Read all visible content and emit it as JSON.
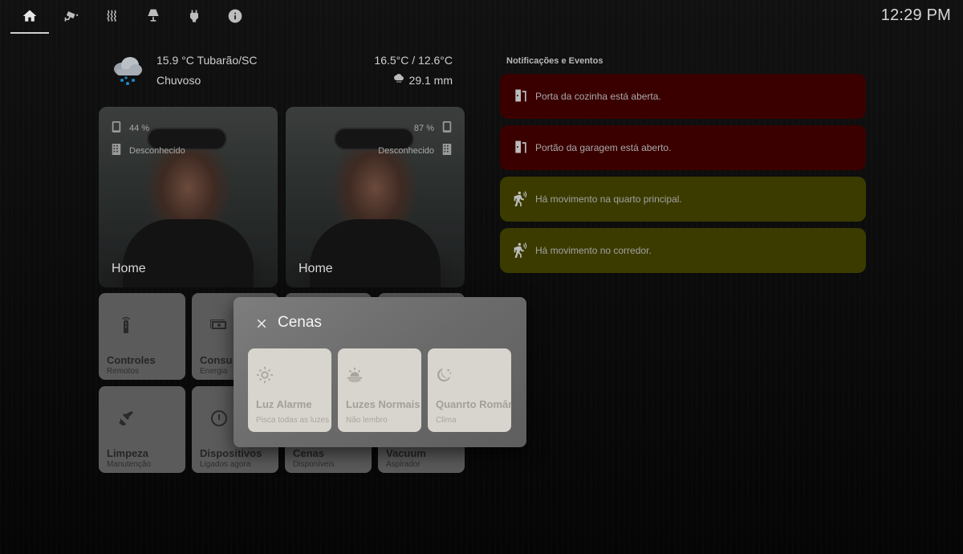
{
  "header": {
    "nav": [
      {
        "icon": "home-icon",
        "active": true
      },
      {
        "icon": "cctv-icon",
        "active": false
      },
      {
        "icon": "radiator-icon",
        "active": false
      },
      {
        "icon": "lamp-icon",
        "active": false
      },
      {
        "icon": "power-plug-icon",
        "active": false
      },
      {
        "icon": "info-icon",
        "active": false
      }
    ],
    "clock": "12:29 PM"
  },
  "weather": {
    "temp_location": "15.9 °C Tubarão/SC",
    "condition": "Chuvoso",
    "range": "16.5°C / 12.6°C",
    "rain": "29.1 mm"
  },
  "persons": [
    {
      "battery": "44 %",
      "status": "Desconhecido",
      "name": "Home"
    },
    {
      "battery": "87 %",
      "status": "Desconhecido",
      "name": "Home"
    }
  ],
  "tiles": [
    {
      "title": "Controles",
      "subtitle": "Remotos",
      "icon": "remote-icon"
    },
    {
      "title": "Consu",
      "subtitle": "Energia",
      "icon": "cash-icon"
    },
    {
      "title": "Limpeza",
      "subtitle": "Manutenção",
      "icon": "broom-icon"
    },
    {
      "title": "Dispositivos",
      "subtitle": "Ligados agora",
      "icon": "power-icon"
    },
    {
      "title": "Cenas",
      "subtitle": "Disponíveis",
      "icon": "palette-icon"
    },
    {
      "title": "Vacuum",
      "subtitle": "Aspirador",
      "icon": "robot-vacuum-icon"
    }
  ],
  "notifications": {
    "title": "Notificações e Eventos",
    "items": [
      {
        "text": "Porta da cozinha está aberta.",
        "type": "door",
        "color": "#3a0000"
      },
      {
        "text": "Portão da garagem está aberto.",
        "type": "door",
        "color": "#3a0000"
      },
      {
        "text": "Há movimento na quarto principal.",
        "type": "motion",
        "color": "#3b3b00"
      },
      {
        "text": "Há movimento no corredor.",
        "type": "motion",
        "color": "#3b3b00"
      }
    ]
  },
  "dialog": {
    "title": "Cenas",
    "scenes": [
      {
        "title": "Luz Alarme",
        "subtitle": "Pisca todas as luzes",
        "icon": "sun-icon"
      },
      {
        "title": "Luzes Normais",
        "subtitle": "Não lembro",
        "icon": "sunrise-icon"
      },
      {
        "title": "Quanrto Romântico",
        "subtitle": "Clima",
        "icon": "moon-stars-icon"
      }
    ]
  }
}
